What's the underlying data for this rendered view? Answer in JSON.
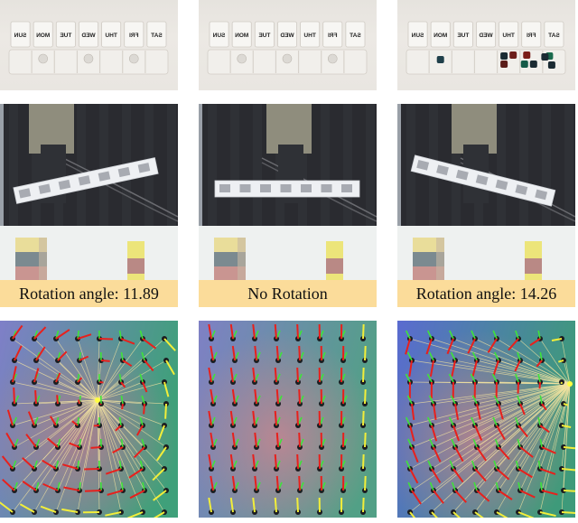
{
  "figure": {
    "columns": [
      {
        "id": "left",
        "pillbox": {
          "day_labels_mirrored": [
            "SUN",
            "MON",
            "TUE",
            "WED",
            "THU",
            "FRI",
            "SAT"
          ],
          "contents": "3 clear pills"
        },
        "rotation_label": "Rotation angle: 11.89",
        "marker_field": "rotation-center-left"
      },
      {
        "id": "center",
        "pillbox": {
          "day_labels_mirrored": [
            "SUN",
            "MON",
            "TUE",
            "WED",
            "THU",
            "FRI",
            "SAT"
          ],
          "contents": "3 clear pills"
        },
        "rotation_label": "No Rotation",
        "marker_field": "uniform-shear"
      },
      {
        "id": "right",
        "pillbox": {
          "day_labels_mirrored": [
            "SUN",
            "MON",
            "TUE",
            "WED",
            "THU",
            "FRI",
            "SAT"
          ],
          "contents": "colored dice-like weights"
        },
        "rotation_label": "Rotation angle: 14.26",
        "marker_field": "rotation-center-right"
      }
    ],
    "colors": {
      "label_bg": "#fbdc9a",
      "arrow_red": "#e8201c",
      "arrow_green": "#3fe33a",
      "arrow_yellow": "#f2ee3a",
      "ray": "#f3e3a0",
      "center_dot": "#ffff40"
    }
  }
}
